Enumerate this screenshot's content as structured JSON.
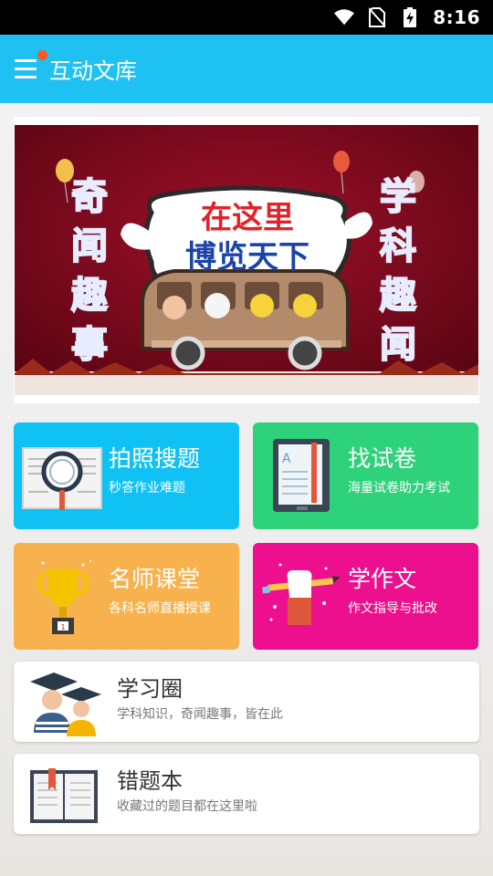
{
  "status_bar": {
    "time": "8:16"
  },
  "app_bar": {
    "title": "互动文库"
  },
  "banner": {
    "left_text": [
      "奇",
      "闻",
      "趣",
      "事"
    ],
    "right_text": [
      "学",
      "科",
      "趣",
      "闻"
    ],
    "sign_line1": "在这里",
    "sign_line2": "博览天下"
  },
  "tiles": [
    {
      "title": "拍照搜题",
      "subtitle": "秒答作业难题",
      "icon": "magnifier-book-icon",
      "color": "#0fc2f3"
    },
    {
      "title": "找试卷",
      "subtitle": "海量试卷助力考试",
      "icon": "exam-paper-icon",
      "color": "#2ed27a"
    },
    {
      "title": "名师课堂",
      "subtitle": "各科名师直播授课",
      "icon": "trophy-icon",
      "color": "#f7b24e"
    },
    {
      "title": "学作文",
      "subtitle": "作文指导与批改",
      "icon": "hand-pencil-icon",
      "color": "#ec0f8e"
    }
  ],
  "cards": [
    {
      "title": "学习圈",
      "subtitle": "学科知识，奇闻趣事，皆在此",
      "icon": "graduates-icon"
    },
    {
      "title": "错题本",
      "subtitle": "收藏过的题目都在这里啦",
      "icon": "open-book-icon"
    }
  ]
}
